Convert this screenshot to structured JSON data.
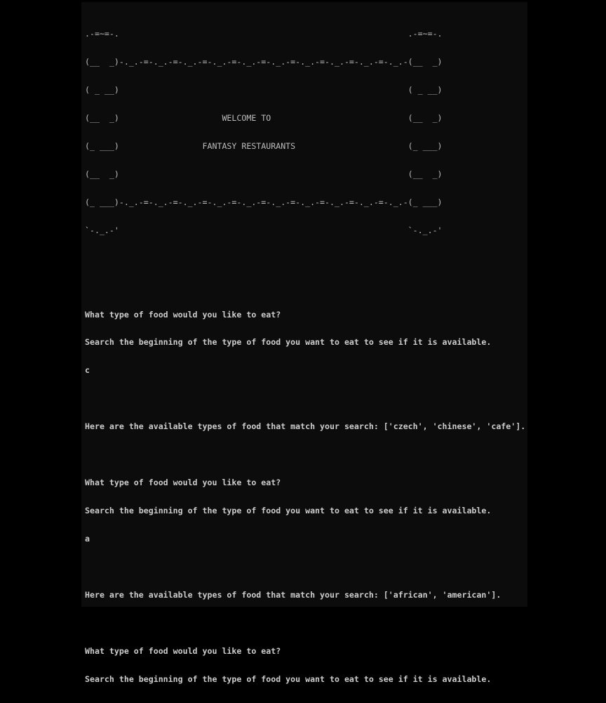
{
  "banner": {
    "lines": [
      ".-=~=-.                                                           .-=~=-.",
      "(__  _)-._.-=-._.-=-._.-=-._.-=-._.-=-._.-=-._.-=-._.-=-._.-=-._.-(__  _)",
      "( _ __)                                                           ( _ __)",
      "(__  _)                     WELCOME TO                            (__  _)",
      "(_ ___)                 FANTASY RESTAURANTS                       (_ ___)",
      "(__  _)                                                           (__  _)",
      "(_ ___)-._.-=-._.-=-._.-=-._.-=-._.-=-._.-=-._.-=-._.-=-._.-=-._.-(_ ___)",
      "`-._.-'                                                           `-._.-'"
    ]
  },
  "output": {
    "lines": [
      "",
      "",
      "What type of food would you like to eat?",
      "Search the beginning of the type of food you want to eat to see if it is available.",
      "c",
      "",
      "Here are the available types of food that match your search: ['czech', 'chinese', 'cafe'].",
      "",
      "What type of food would you like to eat?",
      "Search the beginning of the type of food you want to eat to see if it is available.",
      "a",
      "",
      "Here are the available types of food that match your search: ['african', 'american'].",
      "",
      "What type of food would you like to eat?",
      "Search the beginning of the type of food you want to eat to see if it is available."
    ]
  }
}
